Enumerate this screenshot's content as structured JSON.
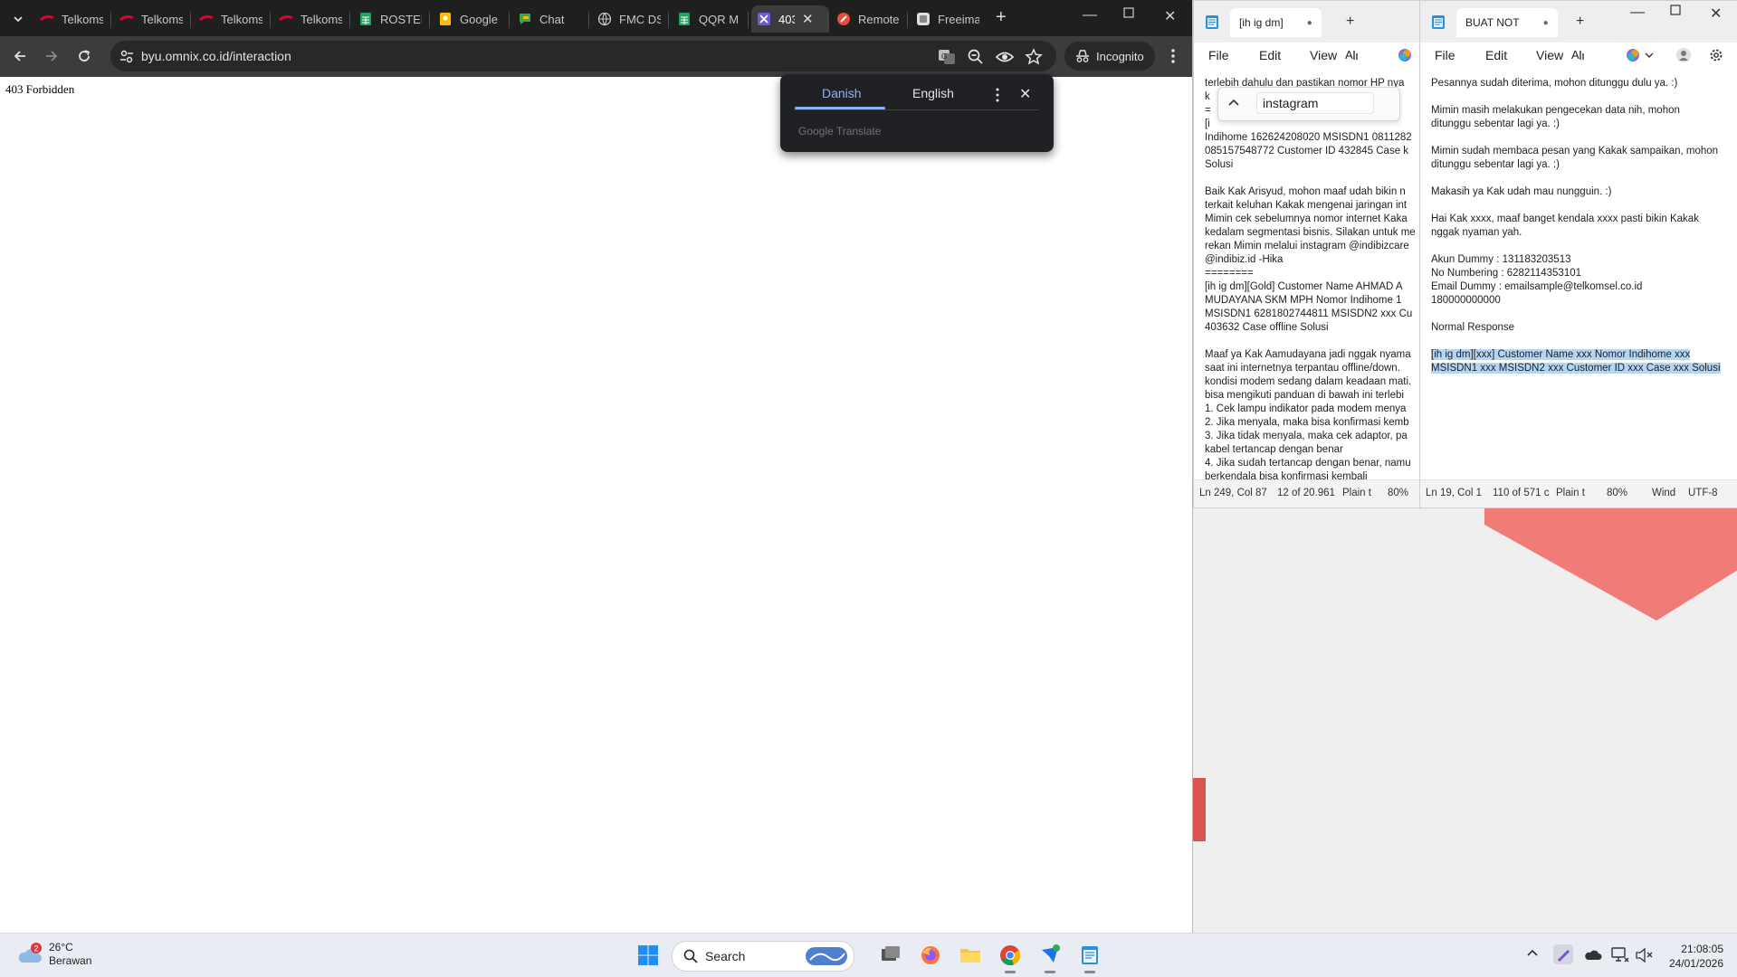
{
  "browser": {
    "tabs": [
      {
        "title": "Telkomsel",
        "icon": "telkomsel-icon",
        "color": "#e4002b"
      },
      {
        "title": "Telkomsel",
        "icon": "telkomsel-icon",
        "color": "#e4002b"
      },
      {
        "title": "Telkomsel",
        "icon": "telkomsel-icon",
        "color": "#e4002b"
      },
      {
        "title": "Telkomsel",
        "icon": "telkomsel-icon",
        "color": "#e4002b"
      },
      {
        "title": "ROSTER",
        "icon": "sheets-icon",
        "color": "#1fa463"
      },
      {
        "title": "Google",
        "icon": "keep-icon",
        "color": "#fbbc04"
      },
      {
        "title": "Chat",
        "icon": "chat-icon",
        "color": "#34a853"
      },
      {
        "title": "FMC DS",
        "icon": "globe-icon",
        "color": "#c7c7c7"
      },
      {
        "title": "QQR M",
        "icon": "sheets-icon",
        "color": "#1fa463"
      },
      {
        "title": "403",
        "icon": "omnix-icon",
        "color": "#6b5bd2"
      },
      {
        "title": "Remote",
        "icon": "remote-icon",
        "color": "#e74c3c"
      },
      {
        "title": "Freeima",
        "icon": "image-icon",
        "color": "#e0e0e0"
      }
    ],
    "url": "byu.omnix.co.id/interaction",
    "incognito_label": "Incognito",
    "page_text": "403 Forbidden",
    "translate_popup": {
      "source_lang": "Danish",
      "target_lang": "English",
      "brand": "Google Translate"
    }
  },
  "notepad1": {
    "tab_title": "[ih ig dm]",
    "menu": [
      "File",
      "Edit",
      "View"
    ],
    "find_query": "instagram",
    "lines": [
      "terlebih dahulu dan pastikan nomor HP nya",
      "k",
      "=",
      "[i",
      "Indihome 162624208020 MSISDN1 0811282",
      "085157548772 Customer ID 432845 Case k",
      "Solusi",
      "",
      "Baik Kak Arisyud, mohon maaf udah bikin n",
      "terkait keluhan Kakak mengenai jaringan int",
      "Mimin cek sebelumnya nomor internet Kaka",
      "kedalam segmentasi bisnis. Silakan untuk me",
      "rekan Mimin melalui instagram @indibizcare",
      "@indibiz.id -Hika",
      "========",
      "[ih ig dm][Gold] Customer Name AHMAD A",
      "MUDAYANA SKM MPH Nomor Indihome 1",
      "MSISDN1 6281802744811 MSISDN2 xxx Cu",
      "403632 Case offline Solusi",
      "",
      "Maaf ya Kak Aamudayana jadi nggak nyama",
      "saat ini internetnya terpantau offline/down.",
      "kondisi modem sedang dalam keadaan mati.",
      "bisa mengikuti panduan di bawah ini terlebi",
      "1. Cek lampu indikator pada modem menya",
      "2. Jika menyala, maka bisa konfirmasi kemb",
      "3. Jika tidak menyala, maka cek adaptor, pa",
      "kabel tertancap dengan benar",
      "4. Jika sudah tertancap dengan benar, namu",
      "berkendala bisa konfirmasi kembali"
    ],
    "status": {
      "position": "Ln 249, Col 87",
      "selection": "12 of 20.961",
      "format": "Plain t",
      "zoom": "80%"
    }
  },
  "notepad2": {
    "tab_title": "BUAT NOT",
    "menu": [
      "File",
      "Edit",
      "View"
    ],
    "lines": [
      "Pesannya sudah diterima, mohon ditunggu dulu ya. :)",
      "",
      "Mimin masih melakukan pengecekan data nih, mohon",
      "ditunggu sebentar lagi ya. :)",
      "",
      "Mimin sudah membaca pesan yang Kakak sampaikan, mohon",
      "ditunggu sebentar lagi ya. :)",
      "",
      "Makasih ya Kak udah mau nungguin. :)",
      "",
      "Hai Kak xxxx, maaf banget kendala xxxx pasti bikin Kakak",
      "nggak nyaman yah.",
      "",
      "Akun Dummy : 131183203513",
      "No Numbering : 6282114353101",
      "Email Dummy : emailsample@telkomsel.co.id",
      "180000000000",
      "",
      "Normal Response",
      ""
    ],
    "selected_lines": [
      "[ih ig dm][xxx] Customer Name xxx Nomor Indihome xxx",
      "MSISDN1 xxx MSISDN2 xxx Customer ID xxx Case xxx Solusi"
    ],
    "status": {
      "position": "Ln 19, Col 1",
      "selection": "110 of 571 c",
      "format": "Plain t",
      "zoom": "80%",
      "line_ending": "Wind",
      "encoding": "UTF-8"
    }
  },
  "taskbar": {
    "weather_temp": "26°C",
    "weather_desc": "Berawan",
    "weather_badge": "2",
    "search_label": "Search",
    "time": "21:08:05",
    "date": "24/01/2026"
  },
  "colors": {
    "accent_blue": "#8ab4f8",
    "selection": "#b5d5f5",
    "desktop_shape": "#f07c78"
  }
}
